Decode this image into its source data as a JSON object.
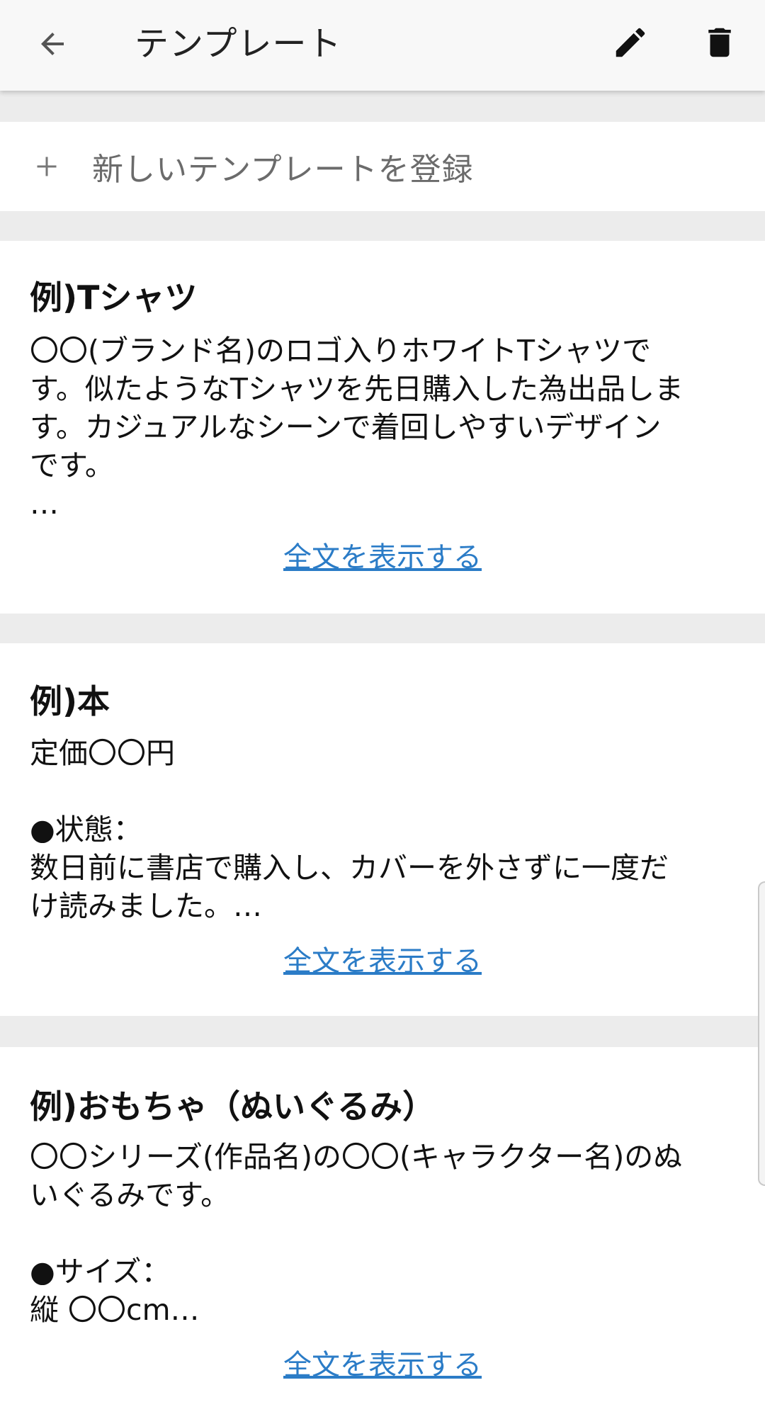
{
  "header": {
    "title": "テンプレート",
    "back_icon": "arrow-back-icon",
    "edit_icon": "pencil-icon",
    "delete_icon": "trash-icon"
  },
  "new_template": {
    "plus": "+",
    "label": "新しいテンプレートを登録"
  },
  "templates": [
    {
      "title": "例)Tシャツ",
      "body": "〇〇(ブランド名)のロゴ入りホワイトTシャツで\nす。似たようなTシャツを先日購入した為出品しま\nす。カジュアルなシーンで着回しやすいデザイン\nです。\n…",
      "link": "全文を表示する"
    },
    {
      "title": "例)本",
      "body": "定価〇〇円\n\n●状態：\n数日前に書店で購入し、カバーを外さずに一度だ\nけ読みました。…",
      "link": "全文を表示する"
    },
    {
      "title": "例)おもちゃ（ぬいぐるみ）",
      "body": "〇〇シリーズ(作品名)の〇〇(キャラクター名)のぬ\nいぐるみです。\n\n●サイズ：\n縦 〇〇cm…",
      "link": "全文を表示する"
    }
  ],
  "colors": {
    "link": "#2b7cc7",
    "background": "#ececec",
    "header": "#f8f8f8"
  }
}
